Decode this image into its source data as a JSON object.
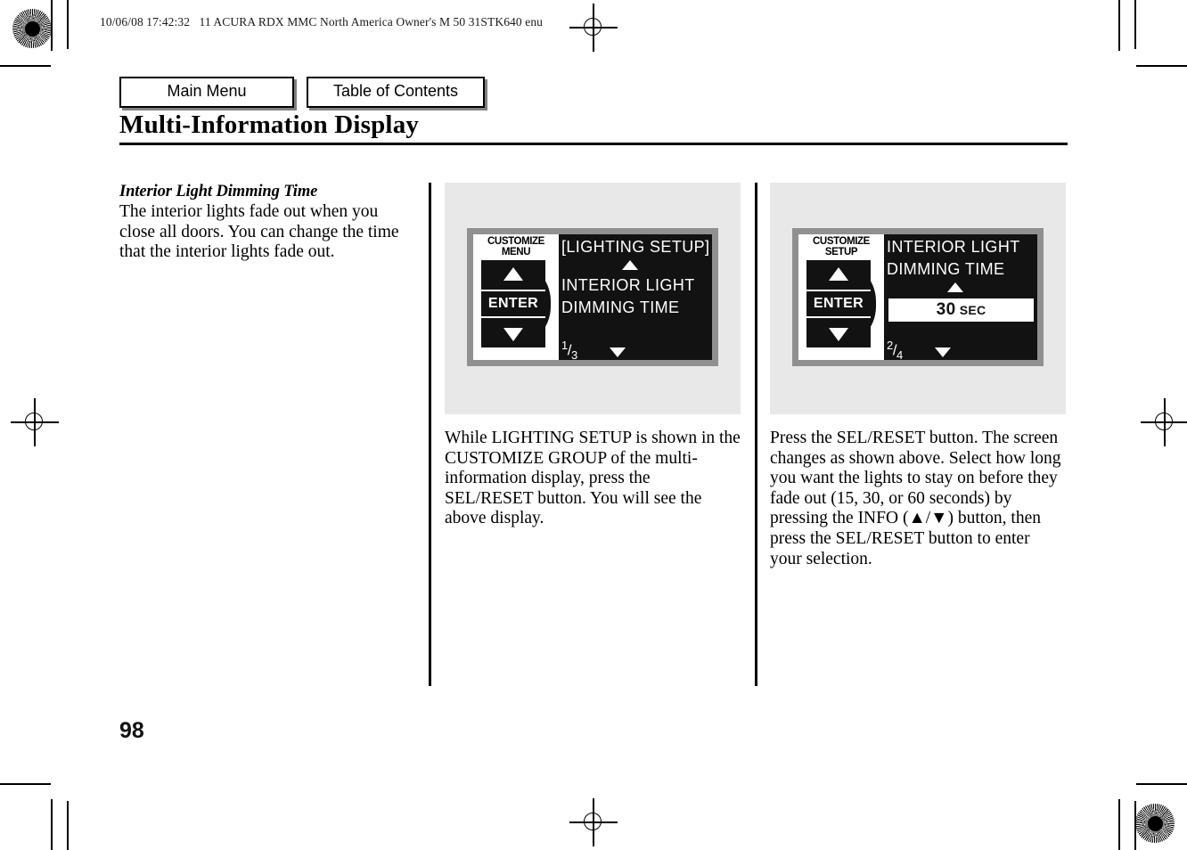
{
  "document": {
    "header_line": "10/06/08 17:42:32   11 ACURA RDX MMC North America Owner's M 50 31STK640 enu",
    "title": "Multi-Information Display",
    "page_number": "98"
  },
  "nav": {
    "main_menu": "Main Menu",
    "table_of_contents": "Table of Contents"
  },
  "columns": {
    "left": {
      "subheading": "Interior Light Dimming Time",
      "body": "The interior lights fade out when you close all doors. You can change the time that the interior lights fade out."
    },
    "middle": {
      "caption": "While LIGHTING SETUP is shown in the CUSTOMIZE GROUP of the multi-information display, press the SEL/RESET button. You will see the above display."
    },
    "right": {
      "caption": "Press the SEL/RESET button. The screen changes as shown above. Select how long you want the lights to stay on before they fade out (15, 30, or 60 seconds) by pressing the INFO (▲/▼) button, then press the SEL/RESET button to enter your selection."
    }
  },
  "lcd_1": {
    "side_title_line1": "CUSTOMIZE",
    "side_title_line2": "MENU",
    "enter_label": "ENTER",
    "heading": "[LIGHTING SETUP]",
    "line1": "INTERIOR LIGHT",
    "line2": "DIMMING TIME",
    "page_indicator_num": "1",
    "page_indicator_den": "3"
  },
  "lcd_2": {
    "side_title_line1": "CUSTOMIZE",
    "side_title_line2": "SETUP",
    "enter_label": "ENTER",
    "line1": "INTERIOR LIGHT",
    "line2": "DIMMING TIME",
    "selected_value": "30",
    "selected_unit": "SEC",
    "page_indicator_num": "2",
    "page_indicator_den": "4"
  },
  "colors": {
    "panel_background": "#e8e8e8",
    "lcd_bezel": "#909090",
    "lcd_screen": "#121212",
    "button_shadow": "#808080"
  }
}
